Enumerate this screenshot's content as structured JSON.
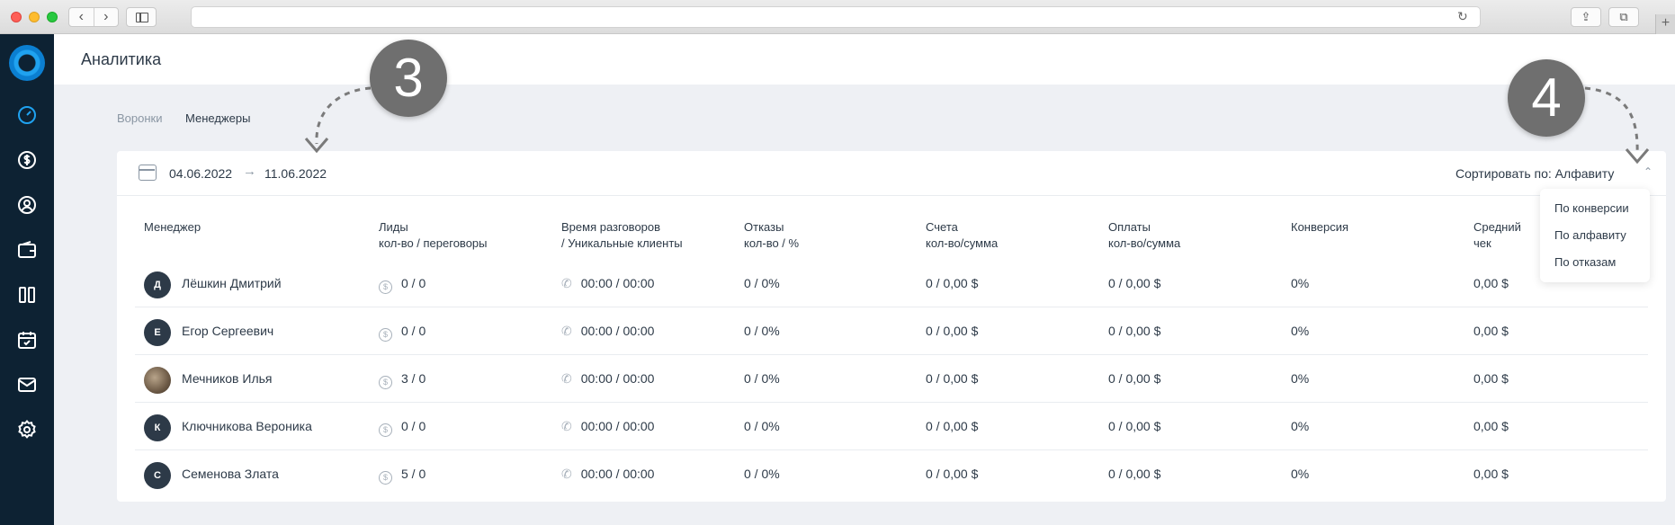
{
  "browser": {
    "url": ""
  },
  "page": {
    "title": "Аналитика"
  },
  "subtabs": [
    "Воронки",
    "Менеджеры"
  ],
  "filter": {
    "date_from": "04.06.2022",
    "arrow": "→",
    "date_to": "11.06.2022",
    "sort_label": "Сортировать по: Алфавиту"
  },
  "table": {
    "headers": [
      [
        "Менеджер",
        ""
      ],
      [
        "Лиды",
        "кол-во / переговоры"
      ],
      [
        "Время разговоров",
        "/ Уникальные клиенты"
      ],
      [
        "Отказы",
        "кол-во / %"
      ],
      [
        "Счета",
        "кол-во/сумма"
      ],
      [
        "Оплаты",
        "кол-во/сумма"
      ],
      [
        "Конверсия",
        ""
      ],
      [
        "Средний",
        "чек"
      ]
    ],
    "rows": [
      {
        "initial": "Д",
        "name": "Лёшкин Дмитрий",
        "leads": "0 / 0",
        "talk": "00:00 / 00:00",
        "refusals": "0 / 0%",
        "invoices": "0 / 0,00 $",
        "payments": "0 / 0,00 $",
        "conversion": "0%",
        "avg": "0,00 $"
      },
      {
        "initial": "Е",
        "name": "Егор Сергеевич",
        "leads": "0 / 0",
        "talk": "00:00 / 00:00",
        "refusals": "0 / 0%",
        "invoices": "0 / 0,00 $",
        "payments": "0 / 0,00 $",
        "conversion": "0%",
        "avg": "0,00 $"
      },
      {
        "initial": "",
        "name": "Мечников Илья",
        "leads": "3 / 0",
        "talk": "00:00 / 00:00",
        "refusals": "0 / 0%",
        "invoices": "0 / 0,00 $",
        "payments": "0 / 0,00 $",
        "conversion": "0%",
        "avg": "0,00 $"
      },
      {
        "initial": "К",
        "name": "Ключникова Вероника",
        "leads": "0 / 0",
        "talk": "00:00 / 00:00",
        "refusals": "0 / 0%",
        "invoices": "0 / 0,00 $",
        "payments": "0 / 0,00 $",
        "conversion": "0%",
        "avg": "0,00 $"
      },
      {
        "initial": "С",
        "name": "Семенова Злата",
        "leads": "5 / 0",
        "talk": "00:00 / 00:00",
        "refusals": "0 / 0%",
        "invoices": "0 / 0,00 $",
        "payments": "0 / 0,00 $",
        "conversion": "0%",
        "avg": "0,00 $"
      }
    ]
  },
  "sort_dropdown": {
    "options": [
      "По конверсии",
      "По алфавиту",
      "По отказам"
    ]
  },
  "annotations": {
    "badge3": "3",
    "badge4": "4"
  },
  "colors": {
    "rail": "#0d2233",
    "accent": "#1fa2f0",
    "badge": "#6f6f6f"
  }
}
